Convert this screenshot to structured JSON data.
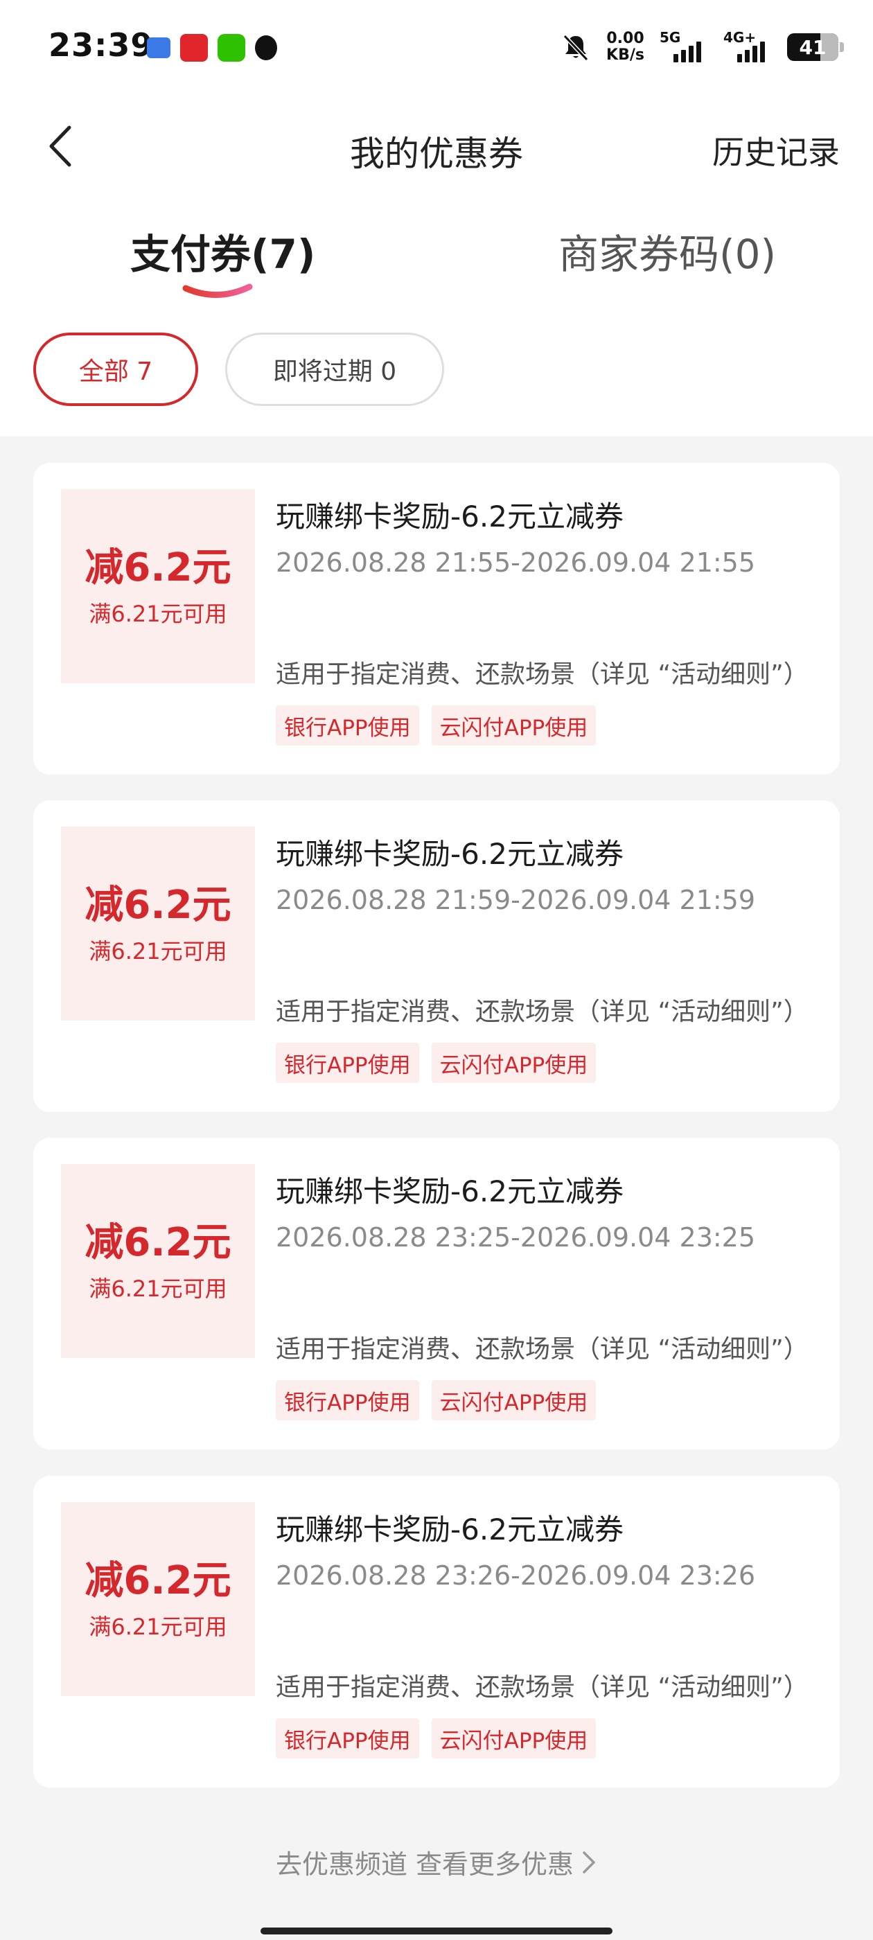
{
  "status_bar": {
    "time": "23:39",
    "net_speed_value": "0.00",
    "net_speed_unit": "KB/s",
    "sim1_label": "5G",
    "sim2_label": "4G+",
    "battery": "41",
    "icons": [
      "message-app-icon",
      "unionpay-app-icon",
      "wechat-icon",
      "qq-icon",
      "bell-muted-icon"
    ]
  },
  "header": {
    "title": "我的优惠券",
    "history": "历史记录"
  },
  "tabs": [
    {
      "label": "支付券(7)",
      "active": true
    },
    {
      "label": "商家券码(0)",
      "active": false
    }
  ],
  "filters": [
    {
      "label": "全部 7",
      "active": true
    },
    {
      "label": "即将过期 0",
      "active": false
    }
  ],
  "coupons": [
    {
      "amount": "减6.2元",
      "condition": "满6.21元可用",
      "title": "玩赚绑卡奖励-6.2元立减券",
      "period": "2026.08.28 21:55-2026.09.04 21:55",
      "desc": "适用于指定消费、还款场景（详见 “活动细则”）",
      "tags": [
        "银行APP使用",
        "云闪付APP使用"
      ]
    },
    {
      "amount": "减6.2元",
      "condition": "满6.21元可用",
      "title": "玩赚绑卡奖励-6.2元立减券",
      "period": "2026.08.28 21:59-2026.09.04 21:59",
      "desc": "适用于指定消费、还款场景（详见 “活动细则”）",
      "tags": [
        "银行APP使用",
        "云闪付APP使用"
      ]
    },
    {
      "amount": "减6.2元",
      "condition": "满6.21元可用",
      "title": "玩赚绑卡奖励-6.2元立减券",
      "period": "2026.08.28 23:25-2026.09.04 23:25",
      "desc": "适用于指定消费、还款场景（详见 “活动细则”）",
      "tags": [
        "银行APP使用",
        "云闪付APP使用"
      ]
    },
    {
      "amount": "减6.2元",
      "condition": "满6.21元可用",
      "title": "玩赚绑卡奖励-6.2元立减券",
      "period": "2026.08.28 23:26-2026.09.04 23:26",
      "desc": "适用于指定消费、还款场景（详见 “活动细则”）",
      "tags": [
        "银行APP使用",
        "云闪付APP使用"
      ]
    }
  ],
  "footer": {
    "more": "去优惠频道 查看更多优惠"
  },
  "colors": {
    "accent": "#d4282d",
    "accent_bg": "#fdeeee",
    "page_bg": "#f4f4f4"
  }
}
